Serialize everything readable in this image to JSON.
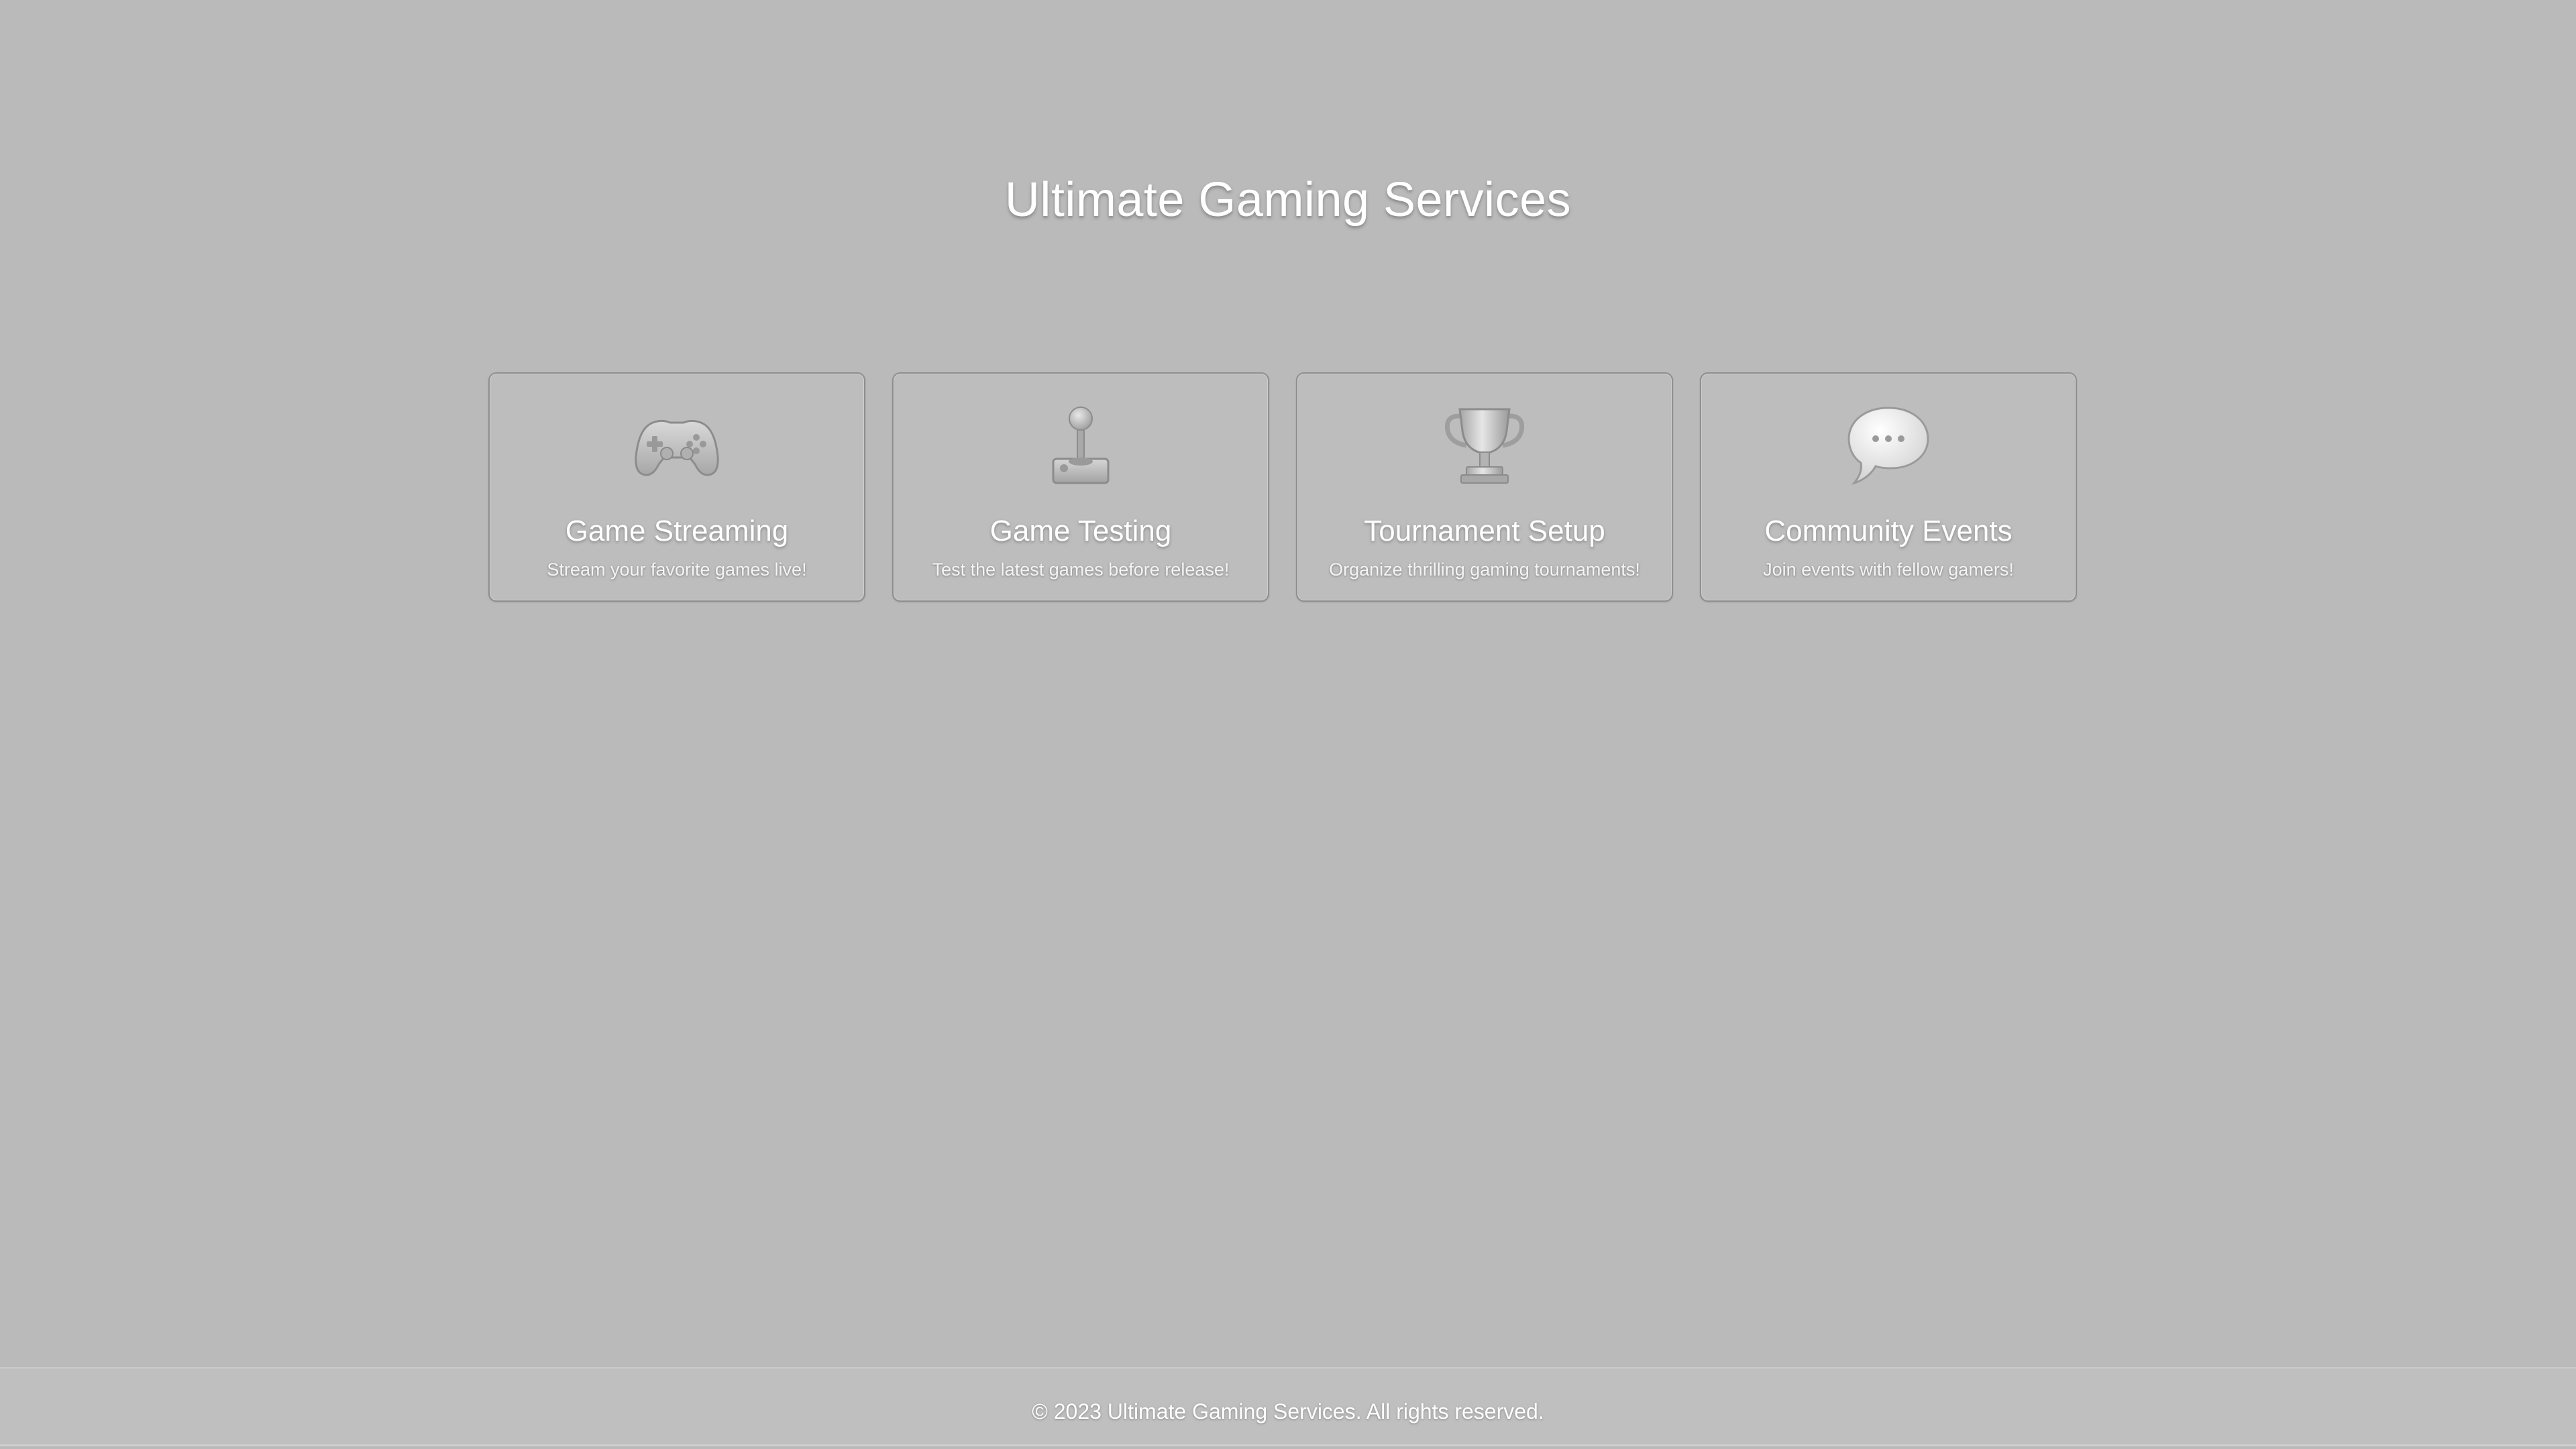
{
  "header": {
    "title": "Ultimate Gaming Services"
  },
  "services": [
    {
      "title": "Game Streaming",
      "description": "Stream your favorite games live!",
      "icon": "game-controller-icon"
    },
    {
      "title": "Game Testing",
      "description": "Test the latest games before release!",
      "icon": "joystick-icon"
    },
    {
      "title": "Tournament Setup",
      "description": "Organize thrilling gaming tournaments!",
      "icon": "trophy-icon"
    },
    {
      "title": "Community Events",
      "description": "Join events with fellow gamers!",
      "icon": "speech-bubble-icon"
    }
  ],
  "footer": {
    "text": "© 2023 Ultimate Gaming Services. All rights reserved."
  },
  "colors": {
    "background": "#bababa",
    "card_border": "#8f8f8f",
    "text": "#ffffff"
  }
}
